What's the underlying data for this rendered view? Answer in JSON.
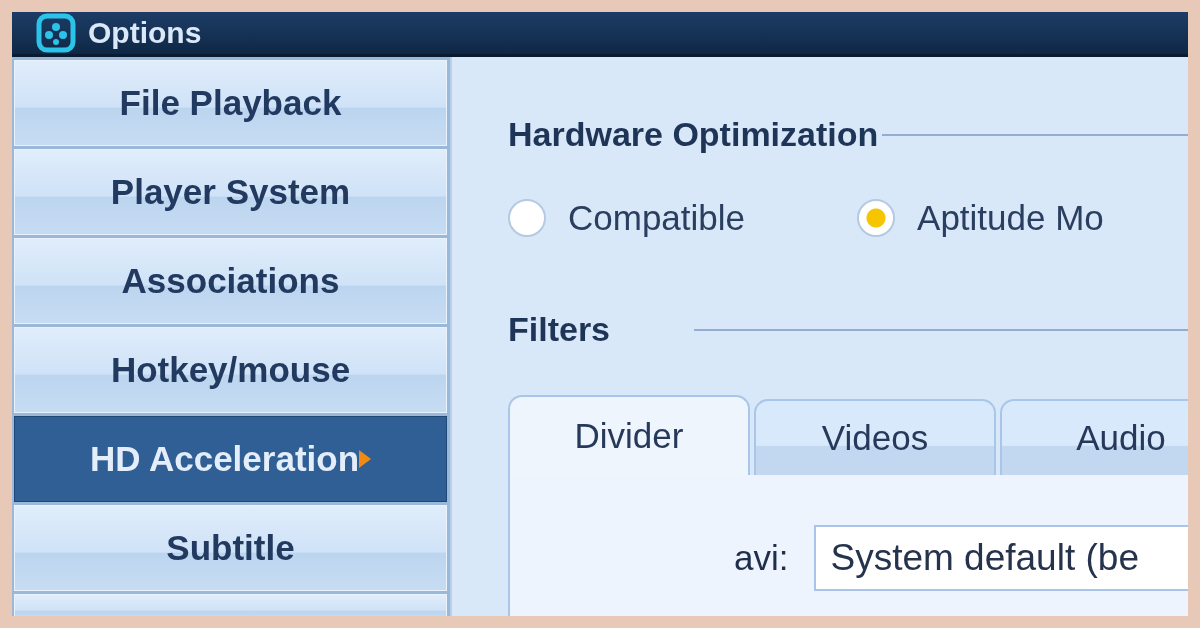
{
  "window": {
    "title": "Options"
  },
  "sidebar": {
    "items": [
      {
        "label": "File Playback",
        "selected": false
      },
      {
        "label": "Player System",
        "selected": false
      },
      {
        "label": "Associations",
        "selected": false
      },
      {
        "label": "Hotkey/mouse",
        "selected": false
      },
      {
        "label": "HD Acceleration",
        "selected": true
      },
      {
        "label": "Subtitle",
        "selected": false
      }
    ]
  },
  "hardware_optimization": {
    "heading": "Hardware Optimization",
    "options": [
      {
        "label": "Compatible",
        "selected": false
      },
      {
        "label": "Aptitude Mo",
        "selected": true
      }
    ]
  },
  "filters": {
    "heading": "Filters",
    "tabs": [
      {
        "label": "Divider",
        "selected": true
      },
      {
        "label": "Videos",
        "selected": false
      },
      {
        "label": "Audio",
        "selected": false
      }
    ],
    "fields": [
      {
        "label": "avi:",
        "value": "System default (be"
      }
    ]
  }
}
